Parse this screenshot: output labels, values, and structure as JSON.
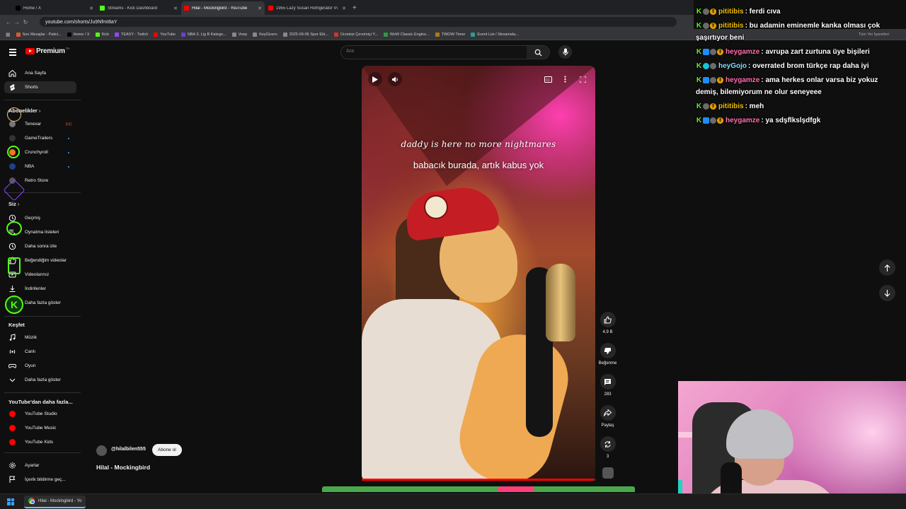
{
  "browser": {
    "tabs": [
      {
        "title": "Home / X",
        "fav_color": "#000000",
        "active": false
      },
      {
        "title": "Streams - Kick Dashboard",
        "fav_color": "#53fc18",
        "active": false
      },
      {
        "title": "Hilal - Mockingbird - YouTube",
        "fav_color": "#ff0000",
        "active": true
      },
      {
        "title": "1955 Lazy Susan Refrigerator Ví",
        "fav_color": "#ff0000",
        "active": false
      }
    ],
    "url": "youtube.com/shorts/Ju9NfmI8aY",
    "bookmarks": [
      {
        "label": "Son Mesajlar - Patici...",
        "color": "#e05a2b"
      },
      {
        "label": "Home / X",
        "color": "#000000"
      },
      {
        "label": "Kick",
        "color": "#53fc18"
      },
      {
        "label": "TEASY - Twitch",
        "color": "#9146ff"
      },
      {
        "label": "YouTube",
        "color": "#ff0000"
      },
      {
        "label": "NBA 3. Lig B Katego...",
        "color": "#6b3fd6"
      },
      {
        "label": "Voep",
        "color": "#888888"
      },
      {
        "label": "KeyGivers",
        "color": "#888888"
      },
      {
        "label": "2025-09-06 Spor Etk...",
        "color": "#888888"
      },
      {
        "label": "Ücretsiz Çevrimiçi Y...",
        "color": "#d93025"
      },
      {
        "label": "WoW Classic Engine...",
        "color": "#2c9b3c"
      },
      {
        "label": "TWOW-Timer",
        "color": "#b07a10"
      },
      {
        "label": "Event List / Streamela...",
        "color": "#2a9d8f"
      }
    ],
    "all_bookmarks": "Tüm Yer İşaretleri"
  },
  "youtube": {
    "logo_text": "Premium",
    "logo_tr": "TR",
    "search_placeholder": "Ara",
    "sidebar": {
      "main": [
        {
          "label": "Ana Sayfa",
          "icon": "home-icon"
        },
        {
          "label": "Shorts",
          "icon": "shorts-icon",
          "active": true
        }
      ],
      "subscriptions_header": "Abonelikler",
      "subscriptions": [
        {
          "label": "Tenexar",
          "color": "#777777",
          "live": true
        },
        {
          "label": "GameTrailers",
          "color": "#333333",
          "dot": true
        },
        {
          "label": "Crunchyroll",
          "color": "#f47521",
          "dot": true
        },
        {
          "label": "NBA",
          "color": "#1d428a",
          "dot": true
        },
        {
          "label": "Retro Store",
          "color": "#555555"
        }
      ],
      "you_header": "Siz",
      "you": [
        {
          "label": "Geçmiş",
          "icon": "history-icon"
        },
        {
          "label": "Oynatma listeleri",
          "icon": "playlist-icon"
        },
        {
          "label": "Daha sonra izle",
          "icon": "clock-icon"
        },
        {
          "label": "Beğendiğim videolar",
          "icon": "like-icon"
        },
        {
          "label": "Videolarınız",
          "icon": "video-icon"
        },
        {
          "label": "İndirilenler",
          "icon": "download-icon"
        },
        {
          "label": "Daha fazla göster",
          "icon": "chevron-down-icon"
        }
      ],
      "explore_header": "Keşfet",
      "explore": [
        {
          "label": "Müzik",
          "icon": "music-icon"
        },
        {
          "label": "Canlı",
          "icon": "live-icon"
        },
        {
          "label": "Oyun",
          "icon": "game-icon"
        },
        {
          "label": "Daha fazla göster",
          "icon": "chevron-down-icon"
        }
      ],
      "more_header": "YouTube'dan daha fazla...",
      "more": [
        {
          "label": "YouTube Studio"
        },
        {
          "label": "YouTube Music"
        },
        {
          "label": "YouTube Kids"
        }
      ],
      "footer": [
        {
          "label": "Ayarlar",
          "icon": "gear-icon"
        },
        {
          "label": "İçerik bildirme geç...",
          "icon": "flag-icon"
        }
      ]
    },
    "short": {
      "caption_en": "daddy is here no more nightmares",
      "caption_tr": "babacık burada, artık kabus yok",
      "progress": 0.99,
      "channel": "@hilalbilen555",
      "subscribe_label": "Abone ol",
      "title": "Hilal - Mockingbird",
      "actions": {
        "likes": "4,9 B",
        "dislike": "Beğenme",
        "comments": "283",
        "share": "Paylaş",
        "remix": "3"
      }
    }
  },
  "taskbar": {
    "app_label": "Hilal - Mockingbird - Yo"
  },
  "chat": [
    {
      "user": "pititibis",
      "user_color": "#f0c000",
      "msg": "ferdi cıva",
      "badges": [
        "kick",
        "gray",
        "gold"
      ]
    },
    {
      "user": "pititibis",
      "user_color": "#f0c000",
      "msg": "bu adamin eminemle kanka olması çok şaşırtıyor beni",
      "badges": [
        "kick",
        "gray",
        "gold"
      ]
    },
    {
      "user": "heygamze",
      "user_color": "#ff6fb0",
      "msg": "avrupa zart zurtuna üye bişileri",
      "badges": [
        "kick",
        "blue",
        "gray",
        "gold"
      ]
    },
    {
      "user": "heyGojo",
      "user_color": "#7be0ff",
      "msg": "overrated brom türkçe rap daha iyi",
      "badges": [
        "kick",
        "cyan",
        "gray"
      ]
    },
    {
      "user": "heygamze",
      "user_color": "#ff6fb0",
      "msg": "ama herkes onlar varsa biz yokuz demiş, bilemiyorum ne olur seneyeee",
      "badges": [
        "kick",
        "blue",
        "gray",
        "gold"
      ]
    },
    {
      "user": "pititibis",
      "user_color": "#f0c000",
      "msg": "meh",
      "badges": [
        "kick",
        "gray",
        "gold"
      ]
    },
    {
      "user": "heygamze",
      "user_color": "#ff6fb0",
      "msg": "ya sdşflkslşdfgk",
      "badges": [
        "kick",
        "blue",
        "gray",
        "gold"
      ]
    }
  ]
}
